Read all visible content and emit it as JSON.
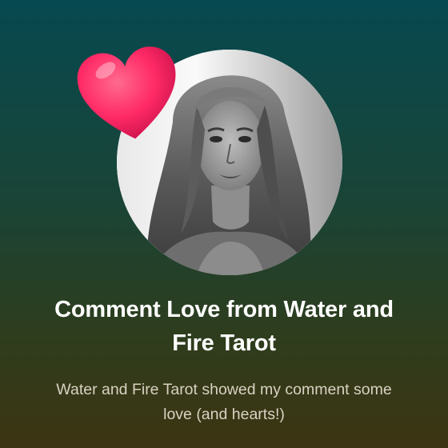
{
  "notification": {
    "title": "Comment Love from Water and Fire Tarot",
    "message": "Water and Fire Tarot showed my comment some love (and hearts!)"
  },
  "icons": {
    "heart": "heart-icon",
    "avatar": "profile-photo"
  },
  "colors": {
    "background_top": "#064950",
    "background_bottom": "#3d3412",
    "heart": "#ff2a66",
    "title": "#ffffff",
    "subtitle": "#d8d2c2"
  }
}
